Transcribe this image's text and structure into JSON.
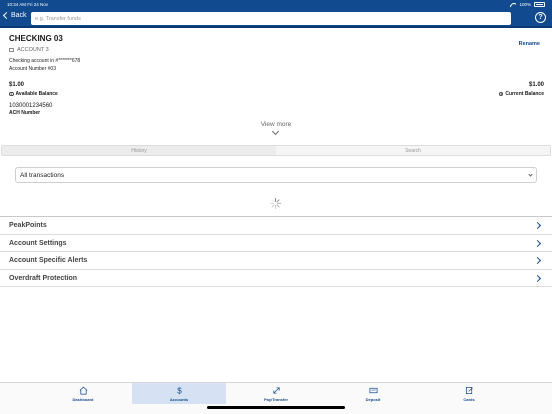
{
  "status_bar": {
    "time_date": "10:34 AM   Fri 24 Nov",
    "battery": "100%"
  },
  "header": {
    "back_label": "Back",
    "search_placeholder": "e.g. Transfer funds",
    "help_label": "?"
  },
  "account": {
    "title": "CHECKING 03",
    "rename_label": "Rename",
    "nickname": "ACCOUNT 3",
    "description": "Checking account in #*******678",
    "account_number": "Account Number #03",
    "available_balance": "$1.00",
    "available_label": "Available Balance",
    "current_balance": "$1.00",
    "current_label": "Current Balance",
    "ach_number": "1030001234560",
    "ach_label": "ACH Number",
    "view_more": "View more"
  },
  "tabs": [
    {
      "label": "History"
    },
    {
      "label": "Search"
    }
  ],
  "filter": {
    "selected": "All transactions"
  },
  "list_items": [
    {
      "label": "PeakPoints"
    },
    {
      "label": "Account Settings"
    },
    {
      "label": "Account Specific Alerts"
    },
    {
      "label": "Overdraft Protection"
    }
  ],
  "bottom_nav": [
    {
      "label": "Dashboard",
      "icon": "home-icon"
    },
    {
      "label": "Accounts",
      "icon": "dollar-icon"
    },
    {
      "label": "Pay/Transfer",
      "icon": "transfer-arrows-icon"
    },
    {
      "label": "Deposit",
      "icon": "check-deposit-icon"
    },
    {
      "label": "Cards",
      "icon": "cards-icon"
    }
  ],
  "colors": {
    "brand": "#114a8f",
    "active_nav": "#d6e2f3"
  }
}
